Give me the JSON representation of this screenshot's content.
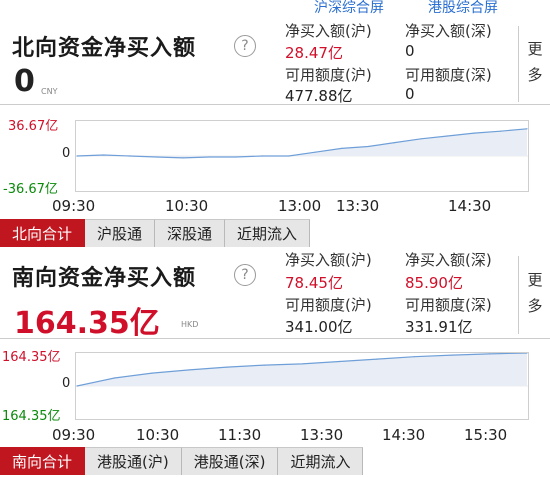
{
  "top_links": [
    "沪深综合屏",
    "港股综合屏"
  ],
  "north": {
    "title": "北向资金净买入额",
    "help": "?",
    "value": "0",
    "unit": "CNY",
    "net_sh_label": "净买入额(沪)",
    "net_sh_value": "28.47亿",
    "net_sz_label": "净买入额(深)",
    "net_sz_value": "0",
    "avail_sh_label": "可用额度(沪)",
    "avail_sh_value": "477.88亿",
    "avail_sz_label": "可用额度(深)",
    "avail_sz_value": "0",
    "more": [
      "更",
      "多"
    ],
    "y_labels": [
      "36.67亿",
      "0",
      "-36.67亿"
    ],
    "x_labels": [
      "09:30",
      "10:30",
      "13:00",
      "13:30",
      "14:30"
    ],
    "tabs": [
      "北向合计",
      "沪股通",
      "深股通",
      "近期流入"
    ]
  },
  "south": {
    "title": "南向资金净买入额",
    "help": "?",
    "value": "164.35亿",
    "unit": "HKD",
    "net_sh_label": "净买入额(沪)",
    "net_sh_value": "78.45亿",
    "net_sz_label": "净买入额(深)",
    "net_sz_value": "85.90亿",
    "avail_sh_label": "可用额度(沪)",
    "avail_sh_value": "341.00亿",
    "avail_sz_label": "可用额度(深)",
    "avail_sz_value": "331.91亿",
    "more": [
      "更",
      "多"
    ],
    "y_labels": [
      "164.35亿",
      "0",
      "164.35亿"
    ],
    "x_labels": [
      "09:30",
      "10:30",
      "11:30",
      "13:30",
      "14:30",
      "15:30"
    ],
    "tabs": [
      "南向合计",
      "港股通(沪)",
      "港股通(深)",
      "近期流入"
    ]
  },
  "colors": {
    "accent_red": "#c0161f",
    "value_red": "#d0102a",
    "value_green": "#0a8a0a",
    "line_blue": "#6f9fd8",
    "area_fill": "#e9eef6",
    "link_blue": "#2a6fd1"
  },
  "chart_data": [
    {
      "type": "area",
      "title": "北向资金净买入额",
      "y_range_labels": [
        "36.67亿",
        "0",
        "-36.67亿"
      ],
      "ylim": [
        -36.67,
        36.67
      ],
      "x_ticks": [
        "09:30",
        "10:30",
        "13:00",
        "13:30",
        "14:30"
      ],
      "x": [
        "09:30",
        "09:45",
        "10:00",
        "10:15",
        "10:30",
        "10:45",
        "11:00",
        "11:15",
        "11:30",
        "13:00",
        "13:15",
        "13:30",
        "13:45",
        "14:00",
        "14:15",
        "14:30",
        "14:45",
        "15:00"
      ],
      "values": [
        0,
        1,
        0,
        -1,
        -2,
        -1,
        -1,
        0,
        0,
        4,
        8,
        10,
        14,
        18,
        21,
        24,
        26,
        28.47
      ]
    },
    {
      "type": "area",
      "title": "南向资金净买入额",
      "y_range_labels": [
        "164.35亿",
        "0",
        "164.35亿"
      ],
      "ylim": [
        -164.35,
        164.35
      ],
      "x_ticks": [
        "09:30",
        "10:30",
        "11:30",
        "13:30",
        "14:30",
        "15:30"
      ],
      "x": [
        "09:30",
        "10:00",
        "10:30",
        "11:00",
        "11:30",
        "12:00",
        "13:00",
        "13:30",
        "14:00",
        "14:30",
        "15:00",
        "15:30",
        "16:00"
      ],
      "values": [
        0,
        40,
        64,
        80,
        94,
        104,
        110,
        122,
        134,
        146,
        154,
        160,
        164.35
      ]
    }
  ]
}
